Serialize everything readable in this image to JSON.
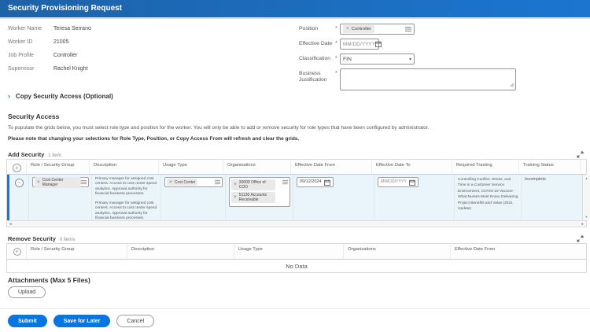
{
  "title": "Security Provisioning Request",
  "worker_info": {
    "fields": [
      {
        "label": "Worker Name",
        "value": "Teresa Serrano"
      },
      {
        "label": "Worker ID",
        "value": "21005"
      },
      {
        "label": "Job Profile",
        "value": "Controller"
      },
      {
        "label": "Supervisor",
        "value": "Rachel Knight"
      }
    ]
  },
  "form": {
    "required_marker": "*",
    "position": {
      "label": "Position",
      "selected": "Controller"
    },
    "effective_date": {
      "label": "Effective Date",
      "placeholder": "MM/DD/YYYY"
    },
    "classification": {
      "label": "Classification",
      "selected": "FIN"
    },
    "business_justification": {
      "label": "Business Justification",
      "value": ""
    }
  },
  "copy_access": {
    "label": "Copy Security Access (Optional)"
  },
  "security_access": {
    "heading": "Security Access",
    "instructions": "To populate the grids below, you must select role type and position for the worker. You will only be able to add or remove security for role types that have been configured by administrator.",
    "note": "Please note that changing your selections for Role Type, Position, or Copy Access From will refresh and clear the grids."
  },
  "add_security": {
    "title": "Add Security",
    "item_count": "1 item",
    "columns": [
      "Role / Security Group",
      "Description",
      "Usage Type",
      "Organizations",
      "Effective Date From",
      "Effective Date To",
      "Required Training",
      "Training Status"
    ],
    "row": {
      "role_security_group": "Cost Center Manager",
      "description_para1": "Primary manager for assigned cost centers. Access to cost center spend analytics. Approval authority for financial business processes.",
      "description_para2": "Primary manager for assigned cost centers. Access to cost center spend analytics. Approval authority for financial business processes.",
      "usage_type": "Cost Center",
      "organizations": [
        "30000 Office of COO",
        "51130 Accounts Receivable"
      ],
      "effective_date_from": "09/12/2024",
      "effective_date_to": "MM/DD/YYYY",
      "required_training": "Controlling Conflict, Stress, and Time in a Customer Service Environment, COVID-19 Vaccine - What Nurses Must Know, Delivering Project Benefits and Value (2021 Update)",
      "training_status": "Incomplete"
    }
  },
  "remove_security": {
    "title": "Remove Security",
    "item_count": "0 items",
    "columns": [
      "Role / Security Group",
      "Description",
      "Usage Type",
      "Organizations",
      "Effective Date From"
    ],
    "empty_text": "No Data"
  },
  "attachments": {
    "heading": "Attachments (Max 5 Files)",
    "upload_label": "Upload"
  },
  "footer": {
    "submit_label": "Submit",
    "save_for_later_label": "Save for Later",
    "cancel_label": "Cancel"
  },
  "icons": {
    "pill_remove": "×",
    "chevron_right": "›",
    "dropdown_caret": "▾",
    "scroll_up": "▲",
    "scroll_down": "▼",
    "scroll_left": "◄",
    "scroll_right": "►"
  },
  "colors": {
    "header_blue_left": "#1e62a8",
    "header_blue_right": "#1b76d1",
    "accent_blue": "#0875e1",
    "required_red": "#d83b3b",
    "row_highlight": "#e9f5fb"
  }
}
